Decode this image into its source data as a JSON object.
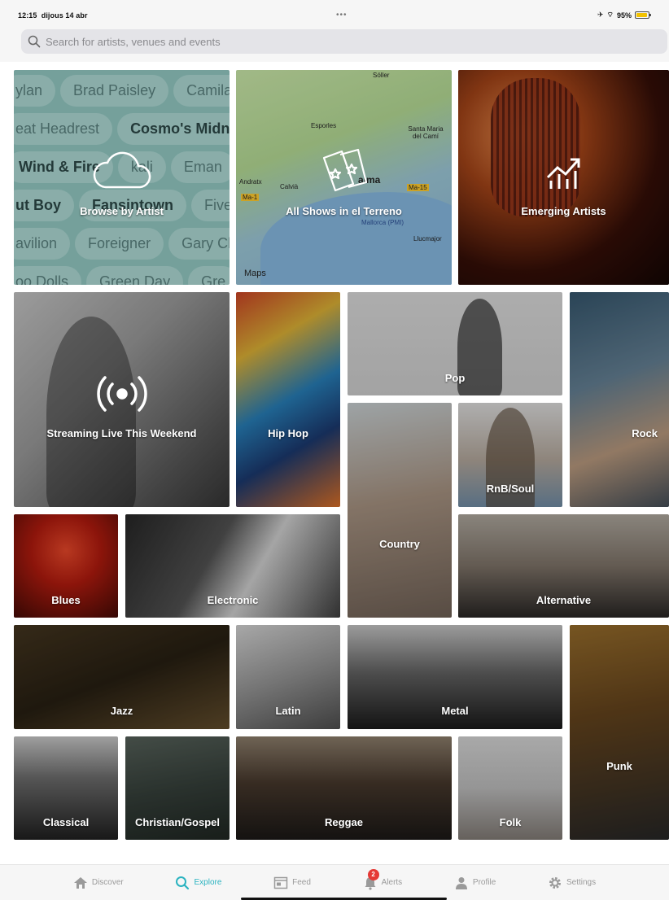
{
  "status_bar": {
    "time": "12:15",
    "date": "dijous 14 abr",
    "dots": "•••",
    "battery": "95%",
    "icons": [
      "airplane-icon",
      "wifi-icon",
      "battery-icon"
    ]
  },
  "search": {
    "placeholder": "Search for artists, venues and events"
  },
  "tiles": {
    "browse_by_artist": "Browse by Artist",
    "all_shows": "All Shows in el Terreno",
    "emerging_artists": "Emerging Artists",
    "streaming_live": "Streaming Live This Weekend",
    "hip_hop": "Hip Hop",
    "pop": "Pop",
    "rock": "Rock",
    "country": "Country",
    "rnb_soul": "RnB/Soul",
    "blues": "Blues",
    "electronic": "Electronic",
    "alternative": "Alternative",
    "jazz": "Jazz",
    "latin": "Latin",
    "metal": "Metal",
    "punk": "Punk",
    "classical": "Classical",
    "christian_gospel": "Christian/Gospel",
    "reggae": "Reggae",
    "folk": "Folk"
  },
  "artist_bubbles": {
    "row1": [
      "ylan",
      "Brad Paisley",
      "Camila"
    ],
    "row2": [
      "eat Headrest",
      "Cosmo's Midni"
    ],
    "row3": [
      "Wind & Fire",
      "kali",
      "Eman"
    ],
    "row4": [
      "ut Boy",
      "Fansintown",
      "Five"
    ],
    "row5": [
      "avilion",
      "Foreigner",
      "Gary Cla"
    ],
    "row6": [
      "oo Dolls",
      "Green Day",
      "Gre"
    ]
  },
  "map": {
    "places": [
      "Sóller",
      "Esporles",
      "Santa Maria del Camí",
      "Andratx",
      "Calvià",
      "alma",
      "Mallorca (PMI)",
      "Llucmajor"
    ],
    "roads": [
      "Ma-1",
      "Ma-15"
    ],
    "logo": "Maps"
  },
  "tab_bar": {
    "tabs": [
      {
        "label": "Discover",
        "icon": "home-icon"
      },
      {
        "label": "Explore",
        "icon": "search-icon"
      },
      {
        "label": "Feed",
        "icon": "feed-icon"
      },
      {
        "label": "Alerts",
        "icon": "bell-icon",
        "badge": "2"
      },
      {
        "label": "Profile",
        "icon": "person-icon"
      },
      {
        "label": "Settings",
        "icon": "gear-icon"
      }
    ],
    "active": "Explore"
  },
  "colors": {
    "accent": "#2bb3c0",
    "badge": "#e53935",
    "battery": "#f2c200"
  }
}
